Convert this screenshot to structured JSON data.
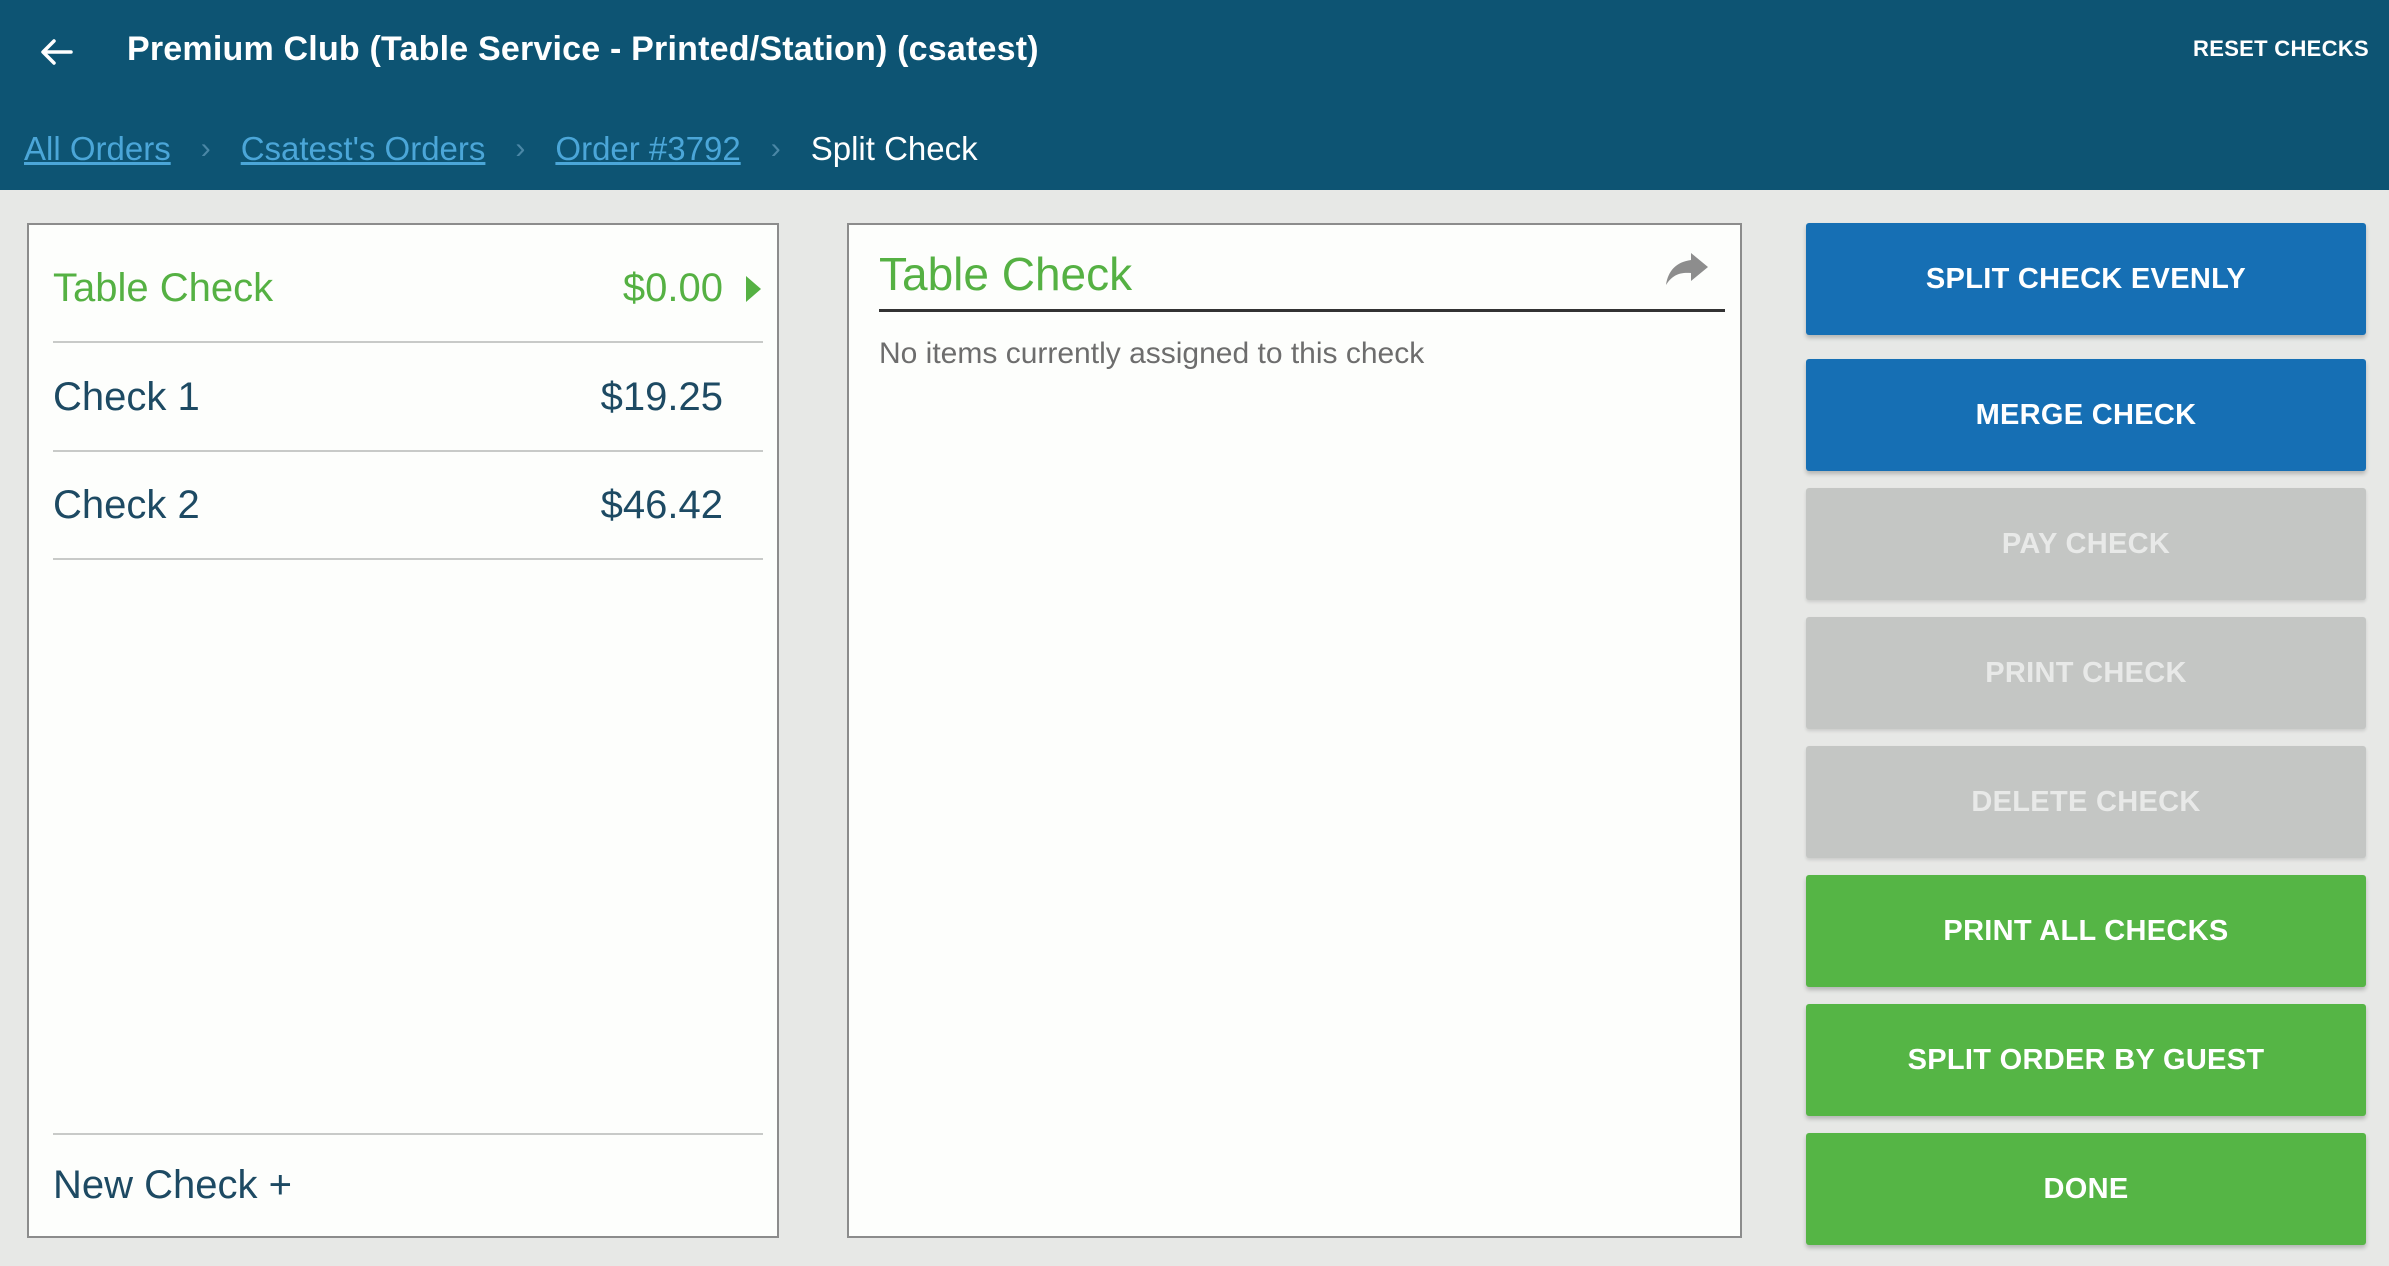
{
  "header": {
    "title": "Premium Club (Table Service - Printed/Station) (csatest)",
    "reset_label": "RESET CHECKS"
  },
  "breadcrumb": {
    "items": [
      "All Orders",
      "Csatest's Orders",
      "Order #3792"
    ],
    "current": "Split Check"
  },
  "checks": [
    {
      "name": "Table Check",
      "amount": "$0.00",
      "active": true
    },
    {
      "name": "Check 1",
      "amount": "$19.25",
      "active": false
    },
    {
      "name": "Check 2",
      "amount": "$46.42",
      "active": false
    }
  ],
  "new_check_label": "New Check +",
  "detail": {
    "title": "Table Check",
    "empty_message": "No items currently assigned to this check",
    "share_icon": "share-forward-icon"
  },
  "actions": {
    "split_evenly": "SPLIT CHECK EVENLY",
    "merge": "MERGE CHECK",
    "pay": "PAY CHECK",
    "print": "PRINT CHECK",
    "delete": "DELETE CHECK",
    "print_all": "PRINT ALL CHECKS",
    "split_by_guest": "SPLIT ORDER BY GUEST",
    "done": "DONE"
  },
  "colors": {
    "header_bg": "#0d5473",
    "link": "#4ba6d8",
    "active_green": "#55b143",
    "button_blue": "#166fb4",
    "button_green": "#55b545",
    "button_disabled": "#c4c6c4",
    "text_dark": "#1d4a63"
  }
}
